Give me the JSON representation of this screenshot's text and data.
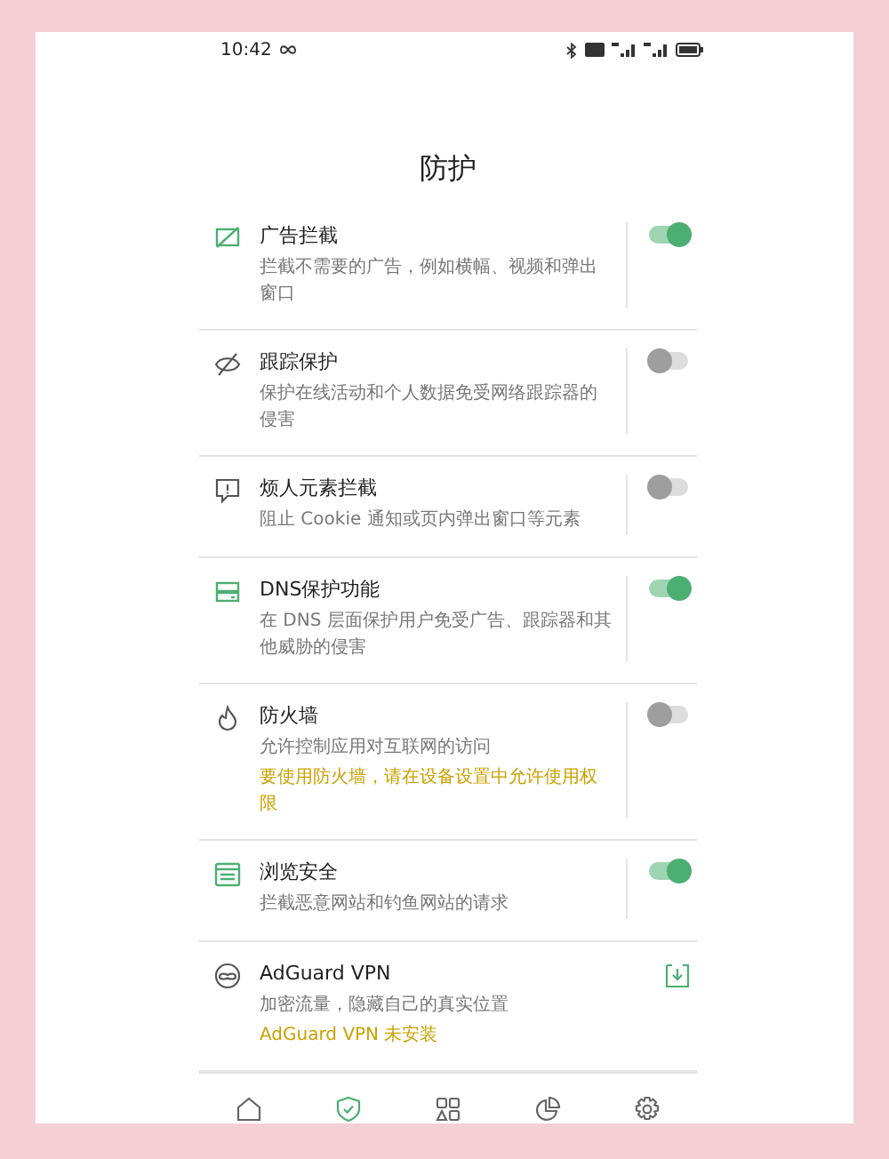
{
  "status_bar": {
    "time": "10:42"
  },
  "title": "防护",
  "items": [
    {
      "kind": "toggle",
      "title": "广告拦截",
      "description": "拦截不需要的广告，例如横幅、视频和弹出窗口",
      "on": true
    },
    {
      "kind": "toggle",
      "title": "跟踪保护",
      "description": "保护在线活动和个人数据免受网络跟踪器的侵害",
      "on": false
    },
    {
      "kind": "toggle",
      "title": "烦人元素拦截",
      "description": "阻止 Cookie 通知或页内弹出窗口等元素",
      "on": false
    },
    {
      "kind": "toggle",
      "title": "DNS保护功能",
      "description": "在 DNS 层面保护用户免受广告、跟踪器和其他威胁的侵害",
      "on": true
    },
    {
      "kind": "toggle",
      "title": "防火墙",
      "description": "允许控制应用对互联网的访问",
      "warning": "要使用防火墙，请在设备设置中允许使用权限",
      "on": false
    },
    {
      "kind": "toggle",
      "title": "浏览安全",
      "description": "拦截恶意网站和钓鱼网站的请求",
      "on": true
    },
    {
      "kind": "install",
      "title": "AdGuard VPN",
      "description": "加密流量，隐藏自己的真实位置",
      "warning": "AdGuard VPN 未安装"
    }
  ],
  "nav": [
    {
      "selected": false
    },
    {
      "selected": true
    },
    {
      "selected": false
    },
    {
      "selected": false
    },
    {
      "selected": false
    }
  ]
}
